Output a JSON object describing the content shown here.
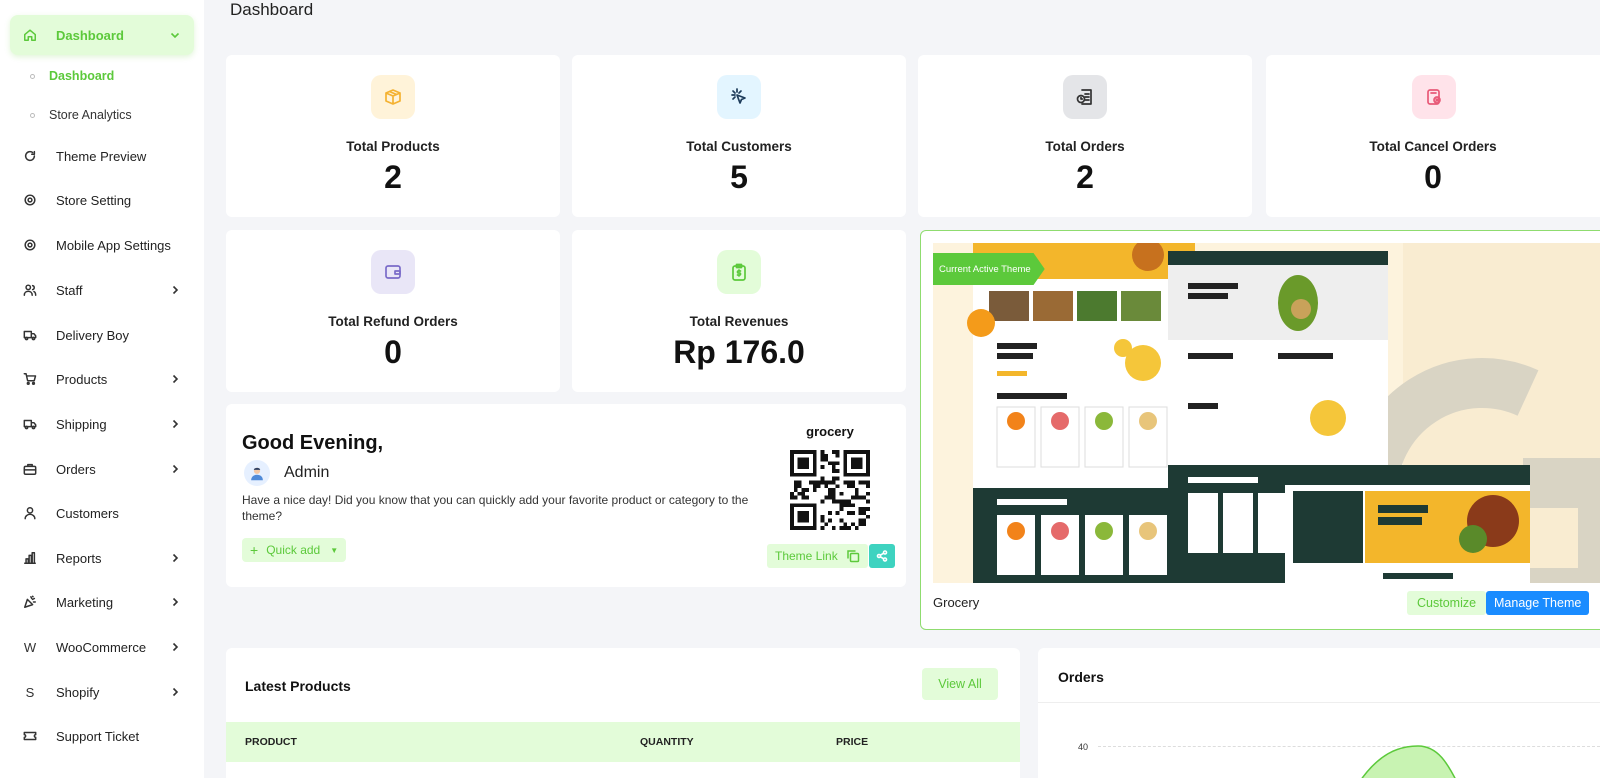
{
  "page_title": "Dashboard",
  "sidebar": {
    "items": [
      {
        "label": "Dashboard",
        "icon": "home-icon",
        "expanded": true
      },
      {
        "label": "Theme Preview",
        "icon": "refresh-icon"
      },
      {
        "label": "Store Setting",
        "icon": "gear-icon"
      },
      {
        "label": "Mobile App Settings",
        "icon": "gear-icon"
      },
      {
        "label": "Staff",
        "icon": "users-icon",
        "has_children": true
      },
      {
        "label": "Delivery Boy",
        "icon": "truck-icon"
      },
      {
        "label": "Products",
        "icon": "cart-icon",
        "has_children": true
      },
      {
        "label": "Shipping",
        "icon": "truck-icon",
        "has_children": true
      },
      {
        "label": "Orders",
        "icon": "briefcase-icon",
        "has_children": true
      },
      {
        "label": "Customers",
        "icon": "user-icon"
      },
      {
        "label": "Reports",
        "icon": "bar-chart-icon",
        "has_children": true
      },
      {
        "label": "Marketing",
        "icon": "confetti-icon",
        "has_children": true
      },
      {
        "label": "WooCommerce",
        "icon": "w-letter-icon",
        "has_children": true
      },
      {
        "label": "Shopify",
        "icon": "s-letter-icon",
        "has_children": true
      },
      {
        "label": "Support Ticket",
        "icon": "ticket-icon"
      }
    ],
    "sub_items": [
      {
        "label": "Dashboard",
        "active": true
      },
      {
        "label": "Store Analytics",
        "active": false
      }
    ]
  },
  "stats": [
    {
      "label": "Total Products",
      "value": "2",
      "icon": "box-icon",
      "bg": "#fff3d9",
      "color": "#f4b232"
    },
    {
      "label": "Total Customers",
      "value": "5",
      "icon": "pointer-click-icon",
      "bg": "#e3f5ff",
      "color": "#1d3b5a"
    },
    {
      "label": "Total Orders",
      "value": "2",
      "icon": "order-clock-icon",
      "bg": "#e4e5e8",
      "color": "#333333"
    },
    {
      "label": "Total Cancel Orders",
      "value": "0",
      "icon": "cancel-order-icon",
      "bg": "#ffe3ea",
      "color": "#e85a78"
    },
    {
      "label": "Total Refund Orders",
      "value": "0",
      "icon": "wallet-icon",
      "bg": "#e9e6f7",
      "color": "#7a6bc9"
    },
    {
      "label": "Total Revenues",
      "value": "Rp 176.0",
      "icon": "clipboard-dollar-icon",
      "bg": "#e3fcd9",
      "color": "#5cc93b"
    }
  ],
  "greeting": {
    "title": "Good Evening,",
    "user": "Admin",
    "message": "Have a nice day! Did you know that you can quickly add your favorite product or category to the theme?",
    "quick_add": "Quick add",
    "store_name": "grocery",
    "theme_link": "Theme Link"
  },
  "theme": {
    "badge": "Current Active Theme",
    "name": "Grocery",
    "customize": "Customize",
    "manage": "Manage Theme"
  },
  "latest_products": {
    "title": "Latest Products",
    "view_all": "View All",
    "columns": [
      "PRODUCT",
      "QUANTITY",
      "PRICE"
    ]
  },
  "orders": {
    "title": "Orders",
    "axis_tick": "40"
  },
  "colors": {
    "accent": "#5cc93b",
    "accent_bg": "#e3fcd9",
    "primary_blue": "#1a8cff"
  }
}
